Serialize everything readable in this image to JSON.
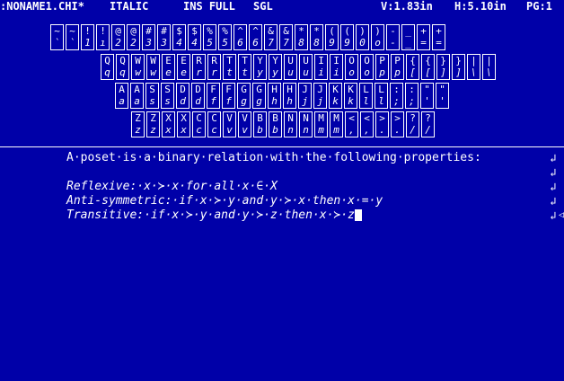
{
  "status": {
    "filename": ":NONAME1.CHI*",
    "font_style": "ITALIC",
    "mode": "INS FULL",
    "spacing": "SGL",
    "vertical_pos": "V:1.83in",
    "horizontal_pos": "H:5.10in",
    "page": "PG:1"
  },
  "keyboard": {
    "rows": [
      {
        "keys": [
          [
            "~",
            "`"
          ],
          [
            "~",
            "`"
          ],
          [
            "!",
            "1"
          ],
          [
            "!",
            "ı"
          ],
          [
            "@",
            "2"
          ],
          [
            "@",
            "2"
          ],
          [
            "#",
            "3"
          ],
          [
            "#",
            "3"
          ],
          [
            "$",
            "4"
          ],
          [
            "$",
            "4"
          ],
          [
            "%",
            "5"
          ],
          [
            "%",
            "5"
          ],
          [
            "^",
            "6"
          ],
          [
            "^",
            "6"
          ],
          [
            "&",
            "7"
          ],
          [
            "&",
            "7"
          ],
          [
            "*",
            "8"
          ],
          [
            "*",
            "8"
          ],
          [
            "(",
            "9"
          ],
          [
            "(",
            "9"
          ],
          [
            ")",
            "0"
          ],
          [
            ")",
            "o"
          ],
          [
            "-",
            "-"
          ],
          [
            "_",
            "_"
          ],
          [
            "+",
            "="
          ],
          [
            "+",
            "="
          ]
        ]
      },
      {
        "keys": [
          [
            "Q",
            "q"
          ],
          [
            "Q",
            "q"
          ],
          [
            "W",
            "w"
          ],
          [
            "W",
            "w"
          ],
          [
            "E",
            "e"
          ],
          [
            "E",
            "e"
          ],
          [
            "R",
            "r"
          ],
          [
            "R",
            "r"
          ],
          [
            "T",
            "t"
          ],
          [
            "T",
            "t"
          ],
          [
            "Y",
            "y"
          ],
          [
            "Y",
            "y"
          ],
          [
            "U",
            "u"
          ],
          [
            "U",
            "u"
          ],
          [
            "I",
            "i"
          ],
          [
            "I",
            "i"
          ],
          [
            "O",
            "o"
          ],
          [
            "O",
            "o"
          ],
          [
            "P",
            "p"
          ],
          [
            "P",
            "p"
          ],
          [
            "{",
            "["
          ],
          [
            "{",
            "["
          ],
          [
            "}",
            "]"
          ],
          [
            "}",
            "]"
          ],
          [
            "|",
            "\\"
          ],
          [
            "|",
            "\\"
          ]
        ]
      },
      {
        "keys": [
          [
            "A",
            "a"
          ],
          [
            "A",
            "a"
          ],
          [
            "S",
            "s"
          ],
          [
            "S",
            "s"
          ],
          [
            "D",
            "d"
          ],
          [
            "D",
            "d"
          ],
          [
            "F",
            "f"
          ],
          [
            "F",
            "f"
          ],
          [
            "G",
            "g"
          ],
          [
            "G",
            "g"
          ],
          [
            "H",
            "h"
          ],
          [
            "H",
            "h"
          ],
          [
            "J",
            "j"
          ],
          [
            "J",
            "j"
          ],
          [
            "K",
            "k"
          ],
          [
            "K",
            "k"
          ],
          [
            "L",
            "l"
          ],
          [
            "L",
            "l"
          ],
          [
            ":",
            ";"
          ],
          [
            ":",
            ";"
          ],
          [
            "\"",
            "'"
          ],
          [
            "\"",
            "'"
          ]
        ]
      },
      {
        "keys": [
          [
            "Z",
            "z"
          ],
          [
            "Z",
            "z"
          ],
          [
            "X",
            "x"
          ],
          [
            "X",
            "x"
          ],
          [
            "C",
            "c"
          ],
          [
            "C",
            "c"
          ],
          [
            "V",
            "v"
          ],
          [
            "V",
            "v"
          ],
          [
            "B",
            "b"
          ],
          [
            "B",
            "b"
          ],
          [
            "N",
            "n"
          ],
          [
            "N",
            "n"
          ],
          [
            "M",
            "m"
          ],
          [
            "M",
            "m"
          ],
          [
            "<",
            ","
          ],
          [
            "<",
            ","
          ],
          [
            ">",
            "."
          ],
          [
            ">",
            "."
          ],
          [
            "?",
            "/"
          ],
          [
            "?",
            "/"
          ]
        ]
      }
    ]
  },
  "document": {
    "lines": [
      "A·poset·is·a·binary·relation·with·the·following·properties:",
      "",
      "Reflexive:·x·≻·x·for·all·x·∈·X",
      "Anti-symmetric:·if·x·≻·y·and·y·≻·x·then·x·=·y",
      "Transitive:·if·x·≻·y·and·y·≻·z·then·x·≻·z"
    ],
    "paragraph_mark": "↲"
  }
}
